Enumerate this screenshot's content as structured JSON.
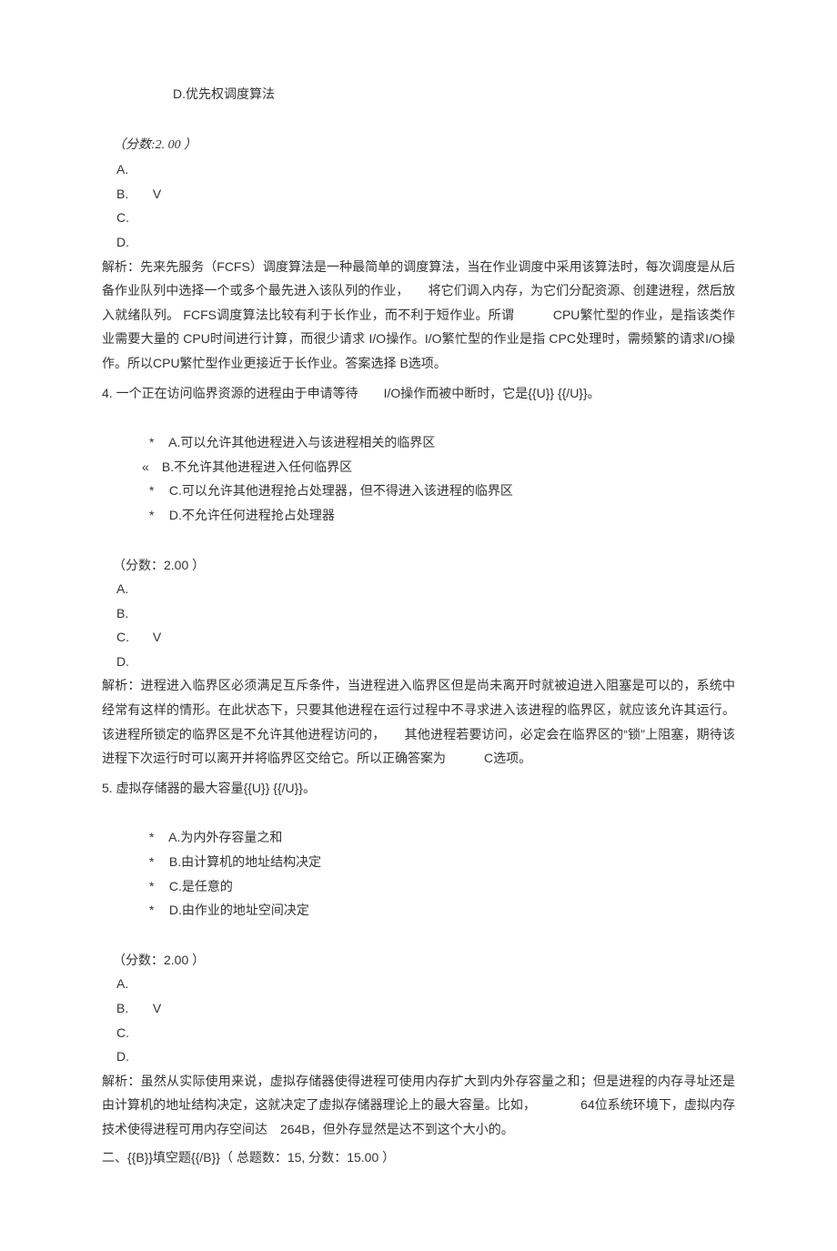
{
  "q3": {
    "optD": "D.优先权调度算法",
    "score": "（分数:2. 00 ）",
    "A": "A.",
    "B_label": "B.",
    "B_mark": "V",
    "C": "C.",
    "D": "D.",
    "analysis": "解析：先来先服务（FCFS）调度算法是一种最简单的调度算法，当在作业调度中采用该算法时，每次调度是从后备作业队列中选择一个或多个最先进入该队列的作业，　　将它们调入内存，为它们分配资源、创建进程，然后放入就绪队列。 FCFS调度算法比较有利于长作业，而不利于短作业。所谓　　　CPU繁忙型的作业，是指该类作业需要大量的 CPU时间进行计算，而很少请求 I/O操作。I/O繁忙型的作业是指 CPC处理时，需频繁的请求I/O操作。所以CPU繁忙型作业更接近于长作业。答案选择 B选项。"
  },
  "q4": {
    "stem_label": "4. ",
    "stem_text": "一个正在访问临界资源的进程由于申请等待　　I/O操作而被中断时，它是{{U}} {{/U}}。",
    "optA_bullet": "*",
    "optA": "A.可以允许其他进程进入与该进程相关的临界区",
    "optB_bullet": "«",
    "optB": "B.不允许其他进程进入任何临界区",
    "optC_bullet": "*",
    "optC": "C.可以允许其他进程抢占处理器，但不得进入该进程的临界区",
    "optD_bullet": "*",
    "optD": "D.不允许任何进程抢占处理器",
    "score": "（分数：2.00 ）",
    "A": "A.",
    "B": "B.",
    "C_label": "C.",
    "C_mark": "V",
    "D": "D.",
    "analysis": "解析：进程进入临界区必须满足互斥条件，当进程进入临界区但是尚未离开时就被迫进入阻塞是可以的，系统中经常有这样的情形。在此状态下，只要其他进程在运行过程中不寻求进入该进程的临界区，就应该允许其运行。该进程所锁定的临界区是不允许其他进程访问的，　　其他进程若要访问，必定会在临界区的“锁”上阻塞，期待该进程下次运行时可以离开并将临界区交给它。所以正确答案为　　　C选项。"
  },
  "q5": {
    "stem_label": "5. ",
    "stem_text": "虚拟存储器的最大容量{{U}} {{/U}}。",
    "optA_bullet": "*",
    "optA": "A.为内外存容量之和",
    "optB_bullet": "*",
    "optB": "B.由计算机的地址结构决定",
    "optC_bullet": "*",
    "optC": "C.是任意的",
    "optD_bullet": "*",
    "optD": "D.由作业的地址空间决定",
    "score": "（分数：2.00 ）",
    "A": "A.",
    "B_label": "B.",
    "B_mark": "V",
    "C": "C.",
    "D": "D.",
    "analysis": "解析：虽然从实际使用来说，虚拟存储器使得进程可使用内存扩大到内外存容量之和；但是进程的内存寻址还是由计算机的地址结构决定，这就决定了虚拟存储器理论上的最大容量。比如，　　　　64位系统环境下，虚拟内存技术使得进程可用内存空间达　264B，但外存显然是达不到这个大小的。"
  },
  "section2": {
    "heading": "二、{{B}}填空题{{/B}}（ 总题数：15, 分数：15.00 ）"
  }
}
